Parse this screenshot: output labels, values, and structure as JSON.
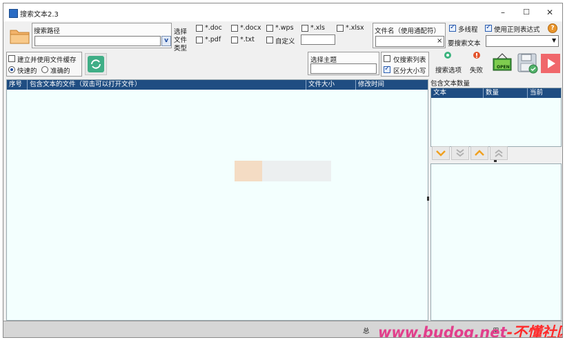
{
  "window": {
    "title": "搜索文本2.3",
    "min_glyph": "–",
    "max_glyph": "☐",
    "close_glyph": "✕"
  },
  "search_path": {
    "label": "搜索路径",
    "value": "",
    "dropdown_glyph": "v"
  },
  "file_types": {
    "label": "选择文件类型",
    "options": [
      {
        "label": "*.doc",
        "checked": false
      },
      {
        "label": "*.docx",
        "checked": false
      },
      {
        "label": "*.wps",
        "checked": false
      },
      {
        "label": "*.xls",
        "checked": false
      },
      {
        "label": "*.xlsx",
        "checked": false
      },
      {
        "label": "*.pdf",
        "checked": false
      },
      {
        "label": "*.txt",
        "checked": false
      },
      {
        "label": "自定义",
        "checked": false
      }
    ],
    "custom_value": ""
  },
  "filename": {
    "label": "文件名（使用通配符）",
    "value": "",
    "clear_glyph": "×"
  },
  "options": {
    "multithread": {
      "label": "多线程",
      "checked": true
    },
    "regex": {
      "label": "使用正则表达式",
      "checked": true
    },
    "search_text_label": "要搜索文本",
    "search_text_value": "",
    "dropdown_glyph": "▼"
  },
  "cache": {
    "checkbox_label": "建立并使用文件缓存",
    "fast_label": "快速的",
    "accurate_label": "准确的",
    "selected": "fast"
  },
  "theme": {
    "label": "选择主题",
    "value": ""
  },
  "list_options": {
    "only_search_list": {
      "label": "仅搜索列表",
      "checked": false
    },
    "case_sensitive": {
      "label": "区分大小写",
      "checked": true
    }
  },
  "toolbar": {
    "search_options_label": "搜索选项",
    "fail_label": "失败",
    "open_label": "OPEN"
  },
  "results_table": {
    "columns": [
      "序号",
      "包含文本的文件（双击可以打开文件）",
      "文件大小",
      "修改时间"
    ],
    "rows": []
  },
  "count_panel": {
    "title": "包含文本数量",
    "columns": [
      "文本",
      "数量",
      "当前"
    ],
    "rows": []
  },
  "statusbar": {
    "total_label": "总",
    "right_text": "用"
  },
  "watermark": {
    "text_pink": "www.budog.net",
    "text_red": "-不懂社区"
  },
  "colors": {
    "header_bg": "#1f4d82",
    "list_bg": "#f3fffe",
    "accent": "#1a49a0"
  }
}
